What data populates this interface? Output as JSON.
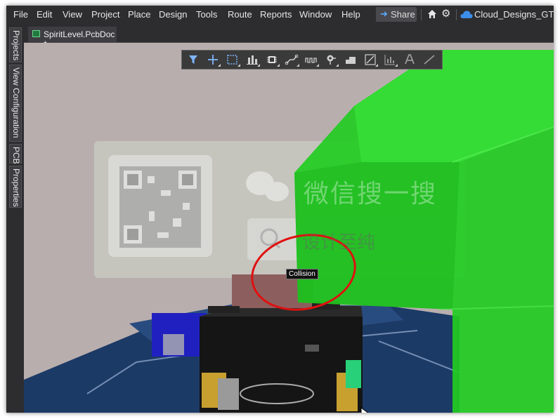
{
  "menu": {
    "items": [
      {
        "label": "File"
      },
      {
        "label": "Edit"
      },
      {
        "label": "View"
      },
      {
        "label": "Project"
      },
      {
        "label": "Place"
      },
      {
        "label": "Design"
      },
      {
        "label": "Tools"
      },
      {
        "label": "Route"
      },
      {
        "label": "Reports"
      },
      {
        "label": "Window"
      },
      {
        "label": "Help"
      }
    ],
    "share_label": "Share",
    "account": "Cloud_Designs_GTD"
  },
  "side_panels": [
    {
      "label": "Projects"
    },
    {
      "label": "View Configuration"
    },
    {
      "label": "PCB"
    },
    {
      "label": "Properties"
    }
  ],
  "document_tab": {
    "label": "SpiritLevel.PcbDoc *"
  },
  "toolbar": {
    "tools": [
      {
        "icon": "filter-icon"
      },
      {
        "icon": "crosshair-icon"
      },
      {
        "icon": "select-rectangle-icon"
      },
      {
        "icon": "align-icon"
      },
      {
        "icon": "component-icon"
      },
      {
        "icon": "route-icon"
      },
      {
        "icon": "interactive-route-icon"
      },
      {
        "icon": "via-icon"
      },
      {
        "icon": "polygon-icon"
      },
      {
        "icon": "dimension-icon"
      },
      {
        "icon": "chart-icon"
      },
      {
        "icon": "text-icon"
      },
      {
        "icon": "line-icon"
      }
    ]
  },
  "watermark": {
    "line1": "微信搜一搜",
    "line2": "设计至纯"
  },
  "tooltip": {
    "text": "Collision"
  },
  "colors": {
    "menubar": "#2d2d30",
    "viewport_bg": "#b9aeae",
    "collision_body": "#22cc22",
    "pcb": "#1c3a66",
    "highlight_circle": "#e01010"
  }
}
